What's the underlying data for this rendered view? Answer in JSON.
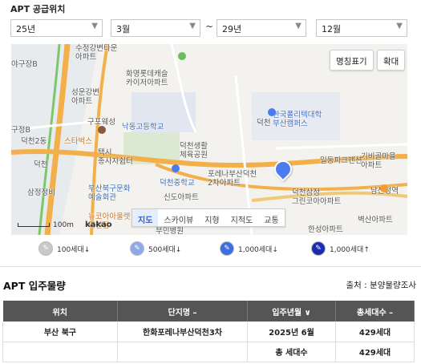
{
  "section_title": "APT 공급위치",
  "filters": {
    "start_year": "25년",
    "start_month": "3월",
    "separator": "~",
    "end_year": "29년",
    "end_month": "12월"
  },
  "map": {
    "buttons": {
      "label_toggle": "명칭표기",
      "zoom": "확대"
    },
    "tabs": [
      "지도",
      "스카이뷰",
      "지형",
      "지적도",
      "교통"
    ],
    "active_tab": "지도",
    "scale_label": "100m",
    "provider": "kakao",
    "labels": {
      "l1": "수정강변타운\n아파트",
      "l2": "화명롯데캐슬\n카이저아파트",
      "l3": "야구장B",
      "l4": "성운강변\n아파트",
      "l5": "구포웨성",
      "l6": "낙동고등학교",
      "l7": "한국폴리텍대학\n부산캠퍼스",
      "l8": "덕천",
      "l9": "구정B",
      "l10": "덕천2동",
      "l11": "스타벅스",
      "l12": "덕천",
      "l13": "택시\n종사자쉼터",
      "l14": "덕천생활\n체육공원",
      "l15": "일동파크맨션",
      "l16": "기비골마을\n아파트",
      "l17": "삼정정비",
      "l18": "부산북구문화\n예술회관",
      "l19": "덕천중학교",
      "l20": "포레나부산덕천\n2차아파트",
      "l21": "신도아파트",
      "l22": "덕천삼정\n그린코아아파트",
      "l23": "남산정역",
      "l24": "뉴코아아울렛\n덕천점",
      "l25": "부민병원",
      "l26": "벽산아파트",
      "l27": "한성아파트"
    }
  },
  "legend": [
    {
      "label": "100세대↓",
      "color": "#c9c9c9"
    },
    {
      "label": "500세대↓",
      "color": "#8fa8e8"
    },
    {
      "label": "1,000세대↓",
      "color": "#3d6de0"
    },
    {
      "label": "1,000세대↑",
      "color": "#1a2db0"
    }
  ],
  "occupancy": {
    "title": "APT 입주물량",
    "source": "출처 : 분양물량조사",
    "headers": [
      "위치",
      "단지명 –",
      "입주년월 ∨",
      "총세대수 –"
    ],
    "rows": [
      [
        "부산 북구",
        "한화포레나부산덕천3차",
        "2025년 6월",
        "429세대"
      ]
    ],
    "total_label": "총 세대수",
    "total_value": "429세대"
  },
  "colors": {
    "header_bg": "#555555",
    "pin": "#4a7cf0",
    "tab_active": "#2a5bd7"
  }
}
